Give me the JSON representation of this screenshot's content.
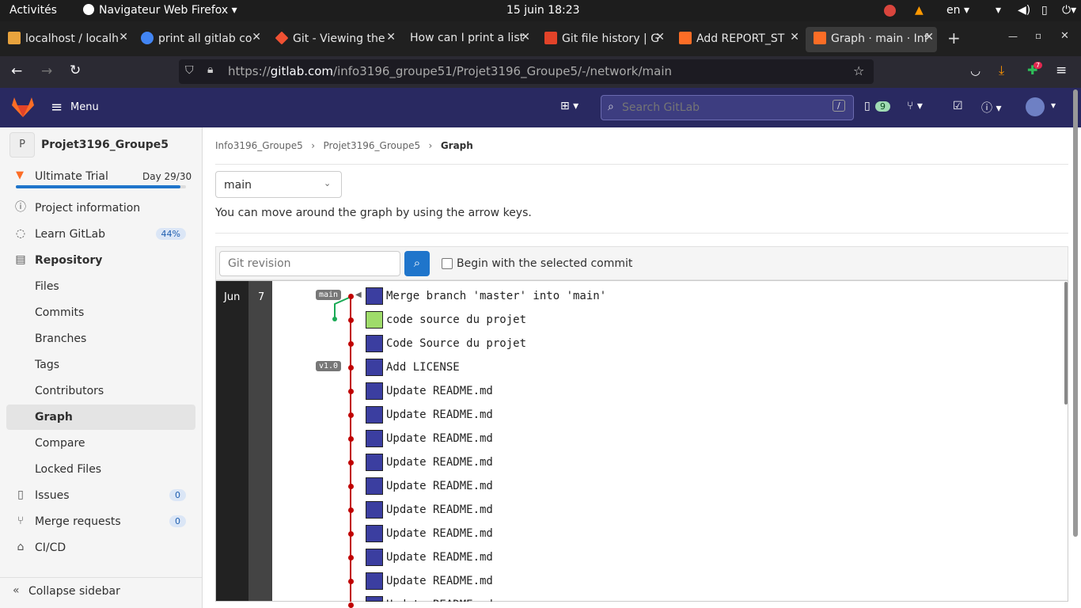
{
  "os": {
    "activities": "Activités",
    "app_menu": "Navigateur Web Firefox",
    "clock": "15 juin  18:23",
    "lang": "en"
  },
  "browser": {
    "tabs": [
      {
        "label": "localhost / localh",
        "color": "#e8a33d"
      },
      {
        "label": "print all gitlab co",
        "color": "#4285f4"
      },
      {
        "label": "Git - Viewing the",
        "color": "#f05133"
      },
      {
        "label": "How can I print a list",
        "color": "#888888"
      },
      {
        "label": "Git file history | G",
        "color": "#e24329"
      },
      {
        "label": "Add REPORT_ST",
        "color": "#fc6d26"
      },
      {
        "label": "Graph · main · Inf",
        "color": "#fc6d26"
      }
    ],
    "new_tab": "+",
    "url_prefix": "https://",
    "url_host": "gitlab.com",
    "url_path": "/info3196_groupe51/Projet3196_Groupe5/-/network/main",
    "downloads_badge": "7"
  },
  "gitlab": {
    "menu_label": "Menu",
    "search_placeholder": "Search GitLab",
    "search_shortcut": "/",
    "issues_count": "9"
  },
  "sidebar": {
    "project_initial": "P",
    "project_name": "Projet3196_Groupe5",
    "trial_label": "Ultimate Trial",
    "trial_day": "Day 29/30",
    "trial_progress": 0.967,
    "items": [
      {
        "label": "Project information",
        "icon": "info-icon"
      },
      {
        "label": "Learn GitLab",
        "icon": "bulb-icon",
        "badge": "44%"
      },
      {
        "label": "Repository",
        "icon": "doc-icon"
      },
      {
        "label": "Files"
      },
      {
        "label": "Commits"
      },
      {
        "label": "Branches"
      },
      {
        "label": "Tags"
      },
      {
        "label": "Contributors"
      },
      {
        "label": "Graph"
      },
      {
        "label": "Compare"
      },
      {
        "label": "Locked Files"
      },
      {
        "label": "Issues",
        "icon": "issues-icon",
        "badge": "0"
      },
      {
        "label": "Merge requests",
        "icon": "merge-icon",
        "badge": "0"
      },
      {
        "label": "CI/CD",
        "icon": "rocket-icon"
      }
    ],
    "collapse": "Collapse sidebar"
  },
  "main": {
    "breadcrumb": [
      "Info3196_Groupe5",
      "Projet3196_Groupe5",
      "Graph"
    ],
    "branch_selected": "main",
    "help_text": "You can move around the graph by using the arrow keys.",
    "revision_placeholder": "Git revision",
    "begin_label": "Begin with the selected commit",
    "month": "Jun",
    "day": "7",
    "branch_label": "main",
    "tag_label": "v1.0",
    "commits": [
      "Merge branch 'master' into 'main'",
      "code source du projet",
      "Code Source du projet",
      "Add LICENSE",
      "Update README.md",
      "Update README.md",
      "Update README.md",
      "Update README.md",
      "Update README.md",
      "Update README.md",
      "Update README.md",
      "Update README.md",
      "Update README.md",
      "Update README.md"
    ]
  },
  "colors": {
    "header": "#292961",
    "graph_line": "#c00000",
    "merge_line": "#1aaa55",
    "accent": "#1f75cb"
  }
}
